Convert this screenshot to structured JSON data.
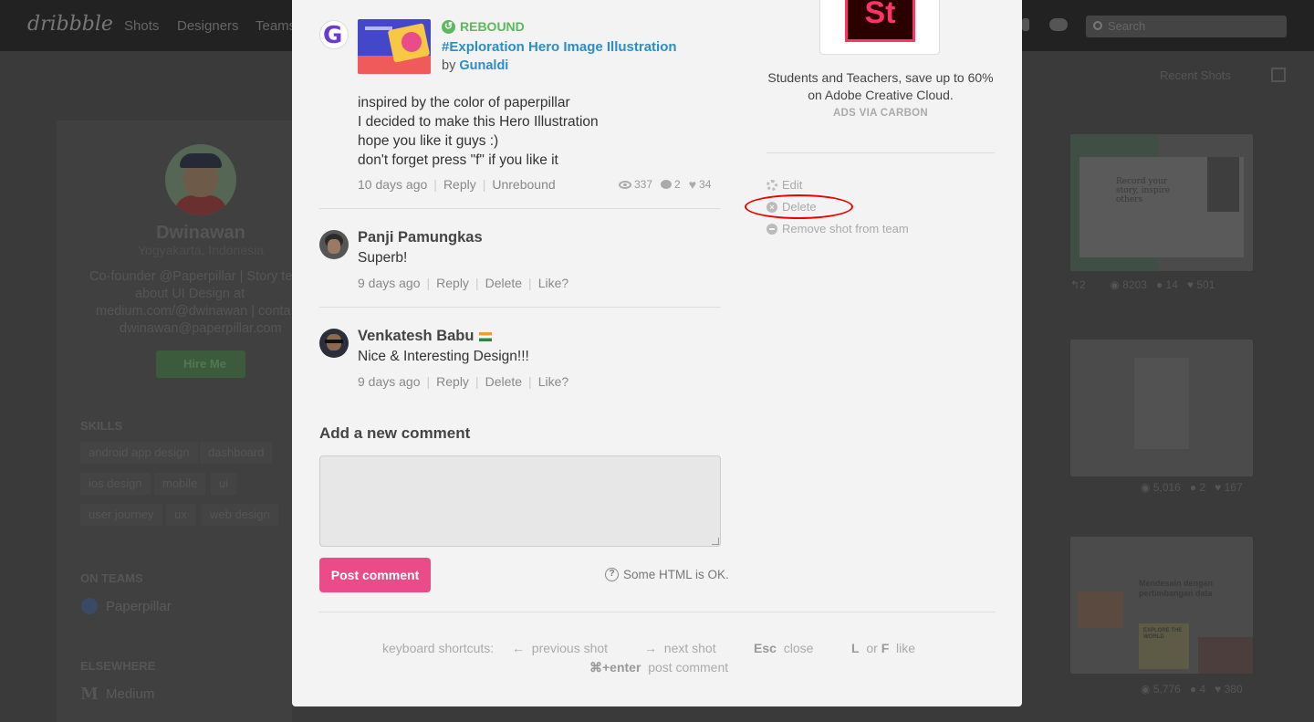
{
  "background": {
    "logo": "dribbble",
    "nav": [
      "Shots",
      "Designers",
      "Teams"
    ],
    "search_placeholder": "Search",
    "profile": {
      "name": "Dwinawan",
      "location": "Yogyakarta, Indonesia",
      "bio_lines": [
        "Co-founder @Paperpillar | Story te",
        "about UI Design at",
        "medium.com/@dwinawan | conta",
        "dwinawan@paperpillar.com"
      ],
      "hire_label": "Hire Me"
    },
    "skills_heading": "SKILLS",
    "skills": [
      "android app design",
      "dashboard",
      "ios design",
      "mobile",
      "ui",
      "user journey",
      "ux",
      "web design"
    ],
    "teams_heading": "ON TEAMS",
    "team": "Paperpillar",
    "elsewhere_heading": "ELSEWHERE",
    "elsewhere": "Medium",
    "sort_label": "Recent Shots",
    "thumb_stats": [
      {
        "rebounds": "2",
        "views": "8203",
        "comments": "14",
        "likes": "501"
      },
      {
        "views": "5,016",
        "comments": "2",
        "likes": "167"
      },
      {
        "views": "5,776",
        "comments": "4",
        "likes": "380"
      }
    ],
    "thumb_texts": {
      "t1": "Record your story, inspire others",
      "t3a": "Mendesain dengan pertimbangan data",
      "t3b": "EXPLORE THE WORLD"
    }
  },
  "rebound": {
    "label": "REBOUND",
    "title": "#Exploration Hero Image Illustration",
    "by_prefix": "by",
    "author": "Gunaldi"
  },
  "description": [
    "inspired by the color of paperpillar",
    "I decided to make this Hero Illustration",
    "hope you like it guys :)",
    "don't forget press \"f\" if you like it"
  ],
  "shot_meta": {
    "time": "10 days ago",
    "reply": "Reply",
    "unrebound": "Unrebound",
    "views": "337",
    "comments": "2",
    "likes": "34"
  },
  "comments": [
    {
      "name": "Panji Pamungkas",
      "text": "Superb!",
      "time": "9 days ago",
      "reply": "Reply",
      "delete": "Delete",
      "like": "Like?"
    },
    {
      "name": "Venkatesh Babu",
      "text": "Nice & Interesting Design!!!",
      "time": "9 days ago",
      "reply": "Reply",
      "delete": "Delete",
      "like": "Like?"
    }
  ],
  "add_comment": {
    "heading": "Add a new comment",
    "button": "Post comment",
    "html_ok": "Some HTML is OK."
  },
  "shortcuts": {
    "label": "keyboard shortcuts:",
    "prev_key": "←",
    "prev": "previous shot",
    "next_key": "→",
    "next": "next shot",
    "close_key": "Esc",
    "close": "close",
    "like_key1": "L",
    "like_or": "or",
    "like_key2": "F",
    "like": "like",
    "post_key": "⌘+enter",
    "post": "post comment"
  },
  "ad": {
    "logo": "St",
    "text": "Students and Teachers, save up to 60% on Adobe Creative Cloud.",
    "via": "ADS VIA CARBON"
  },
  "actions": {
    "edit": "Edit",
    "delete": "Delete",
    "remove": "Remove shot from team"
  },
  "colors": {
    "accent_pink": "#ea4c89",
    "link_blue": "#2a8ec8",
    "rebound_green": "#5cb85c",
    "annotation_red": "#e00000"
  }
}
